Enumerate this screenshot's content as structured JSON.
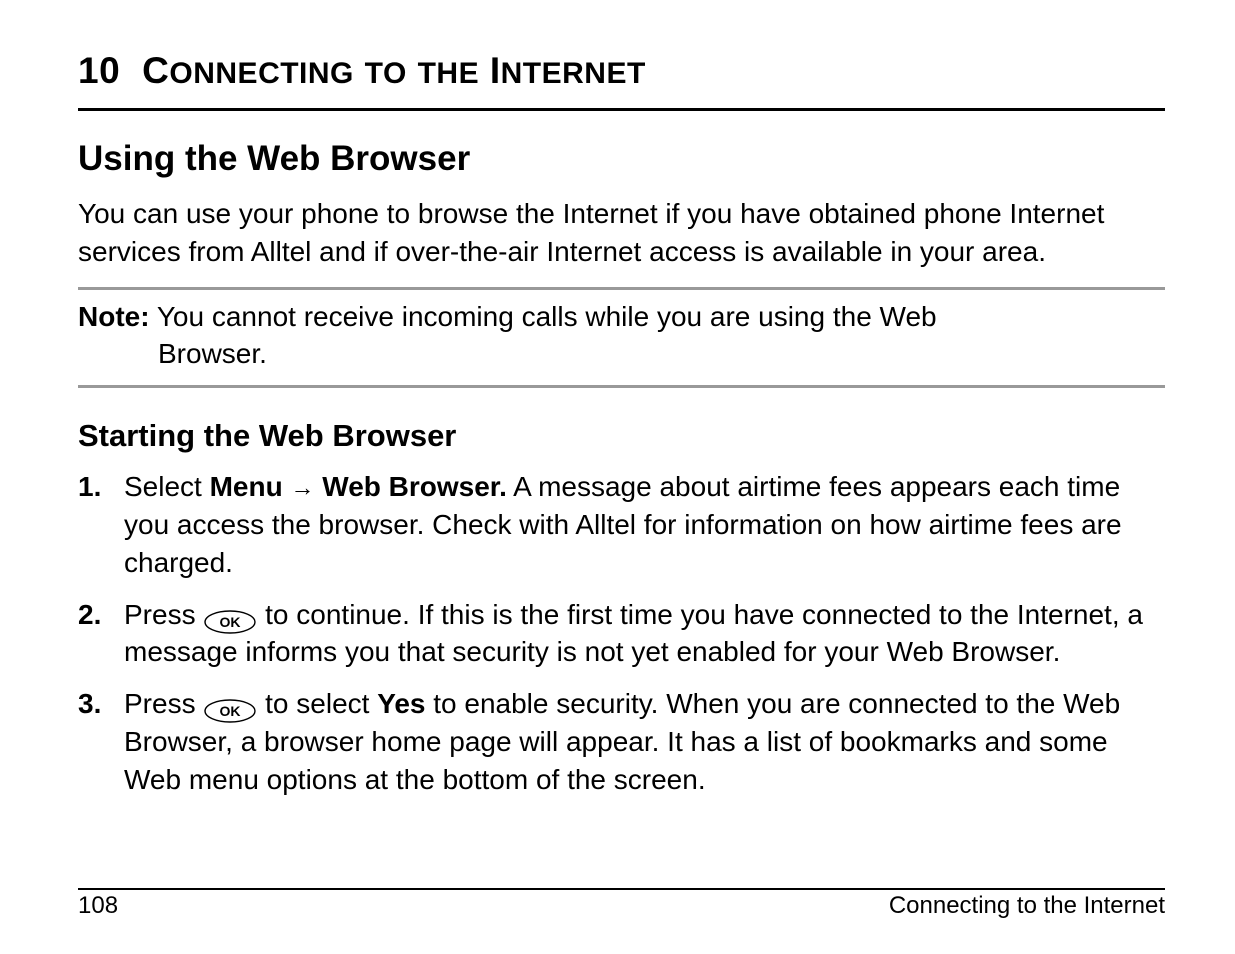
{
  "chapter": {
    "number": "10",
    "title_word1_first": "C",
    "title_word1_rest": "ONNECTING",
    "title_word2_first": "",
    "title_word2_rest": "TO",
    "title_word3_first": "",
    "title_word3_rest": "THE",
    "title_word4_first": "I",
    "title_word4_rest": "NTERNET"
  },
  "sections": {
    "using_title": "Using the Web Browser",
    "using_body": "You can use your phone to browse the Internet if you have obtained phone Internet services from Alltel and if over-the-air Internet access is available in your area.",
    "note_label": "Note:",
    "note_body_line1": "You cannot receive incoming calls while you are using the Web",
    "note_body_line2": "Browser.",
    "starting_title": "Starting the Web Browser",
    "step1_num": "1.",
    "step1_prefix": "Select ",
    "step1_bold1": "Menu",
    "step1_arrow": "→",
    "step1_bold2": "Web Browser.",
    "step1_rest": " A message about airtime fees appears each time you access the browser. Check with Alltel for information on how airtime fees are charged.",
    "step2_num": "2.",
    "step2_prefix": "Press ",
    "step2_rest": " to continue. If this is the first time you have connected to the Internet, a message informs you that security is not yet enabled for your Web Browser.",
    "step3_num": "3.",
    "step3_prefix": "Press ",
    "step3_mid1": " to select ",
    "step3_bold": "Yes",
    "step3_rest": " to enable security. When you are connected to the Web Browser, a browser home page will appear. It has a list of bookmarks and some Web menu options at the bottom of the screen."
  },
  "footer": {
    "page_number": "108",
    "section_label": "Connecting to the Internet"
  },
  "icons": {
    "ok_label": "OK"
  }
}
